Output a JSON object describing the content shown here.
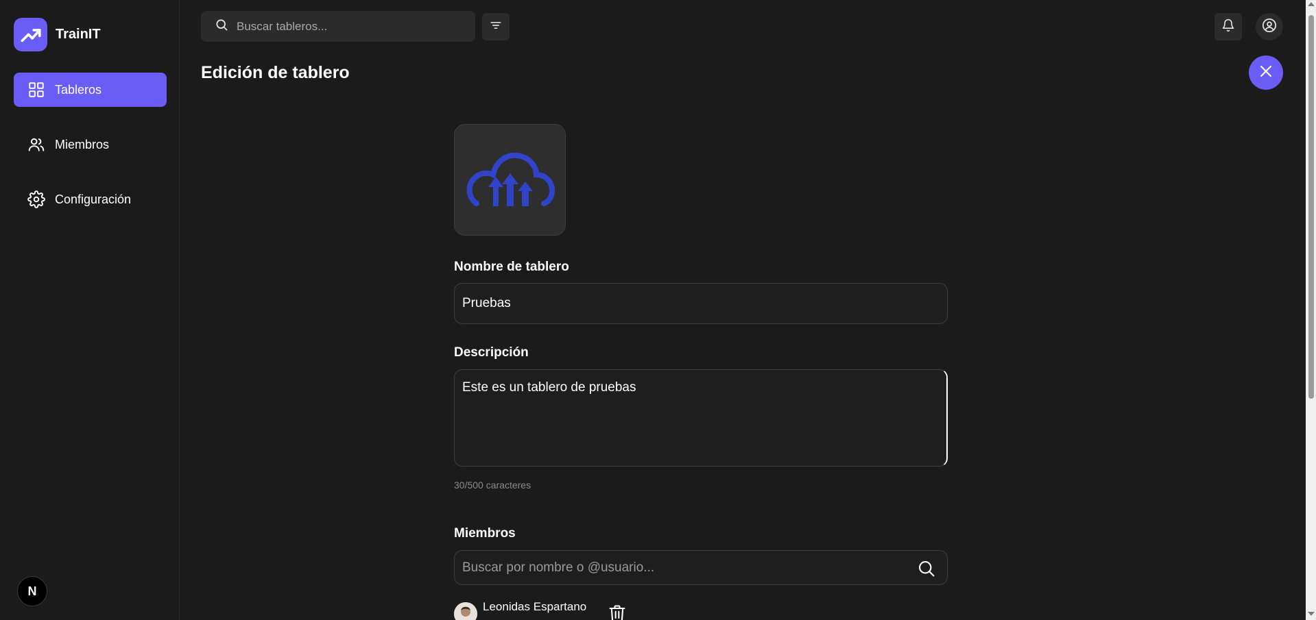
{
  "app": {
    "name": "TrainIT"
  },
  "sidebar": {
    "items": [
      {
        "label": "Tableros",
        "icon": "grid-icon",
        "active": true
      },
      {
        "label": "Miembros",
        "icon": "users-icon",
        "active": false
      },
      {
        "label": "Configuración",
        "icon": "gear-icon",
        "active": false
      }
    ],
    "footer_badge": "N"
  },
  "topbar": {
    "search_placeholder": "Buscar tableros..."
  },
  "page": {
    "title": "Edición de tablero"
  },
  "form": {
    "name_label": "Nombre de tablero",
    "name_value": "Pruebas",
    "description_label": "Descripción",
    "description_value": "Este es un tablero de pruebas",
    "char_count": "30/500 caracteres",
    "members_label": "Miembros",
    "members_search_placeholder": "Buscar por nombre o @usuario...",
    "members": [
      {
        "name": "Leonidas Espartano"
      }
    ]
  },
  "colors": {
    "accent": "#6b5cf6",
    "background": "#1b1b1b",
    "cloud_icon": "#2f44c9"
  }
}
